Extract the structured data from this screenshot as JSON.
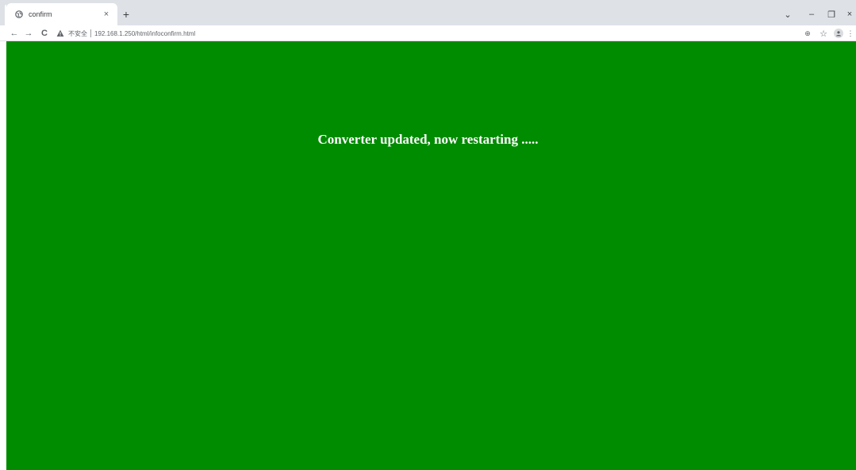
{
  "browser": {
    "tab": {
      "title": "confirm",
      "close_glyph": "×",
      "favicon": "globe-icon"
    },
    "new_tab_glyph": "+",
    "window_controls": {
      "tab_search": "⌄",
      "minimize": "–",
      "restore": "❐",
      "close": "×"
    },
    "toolbar": {
      "back": "←",
      "forward": "→",
      "reload": "C",
      "security_label": "不安全",
      "url": "192.168.1.250/html/infoconfirm.html",
      "zoom_glyph": "⊕",
      "bookmark_glyph": "☆",
      "menu_glyph": "⋮"
    }
  },
  "page": {
    "background_color": "#008c00",
    "message": "Converter updated, now restarting ....."
  }
}
